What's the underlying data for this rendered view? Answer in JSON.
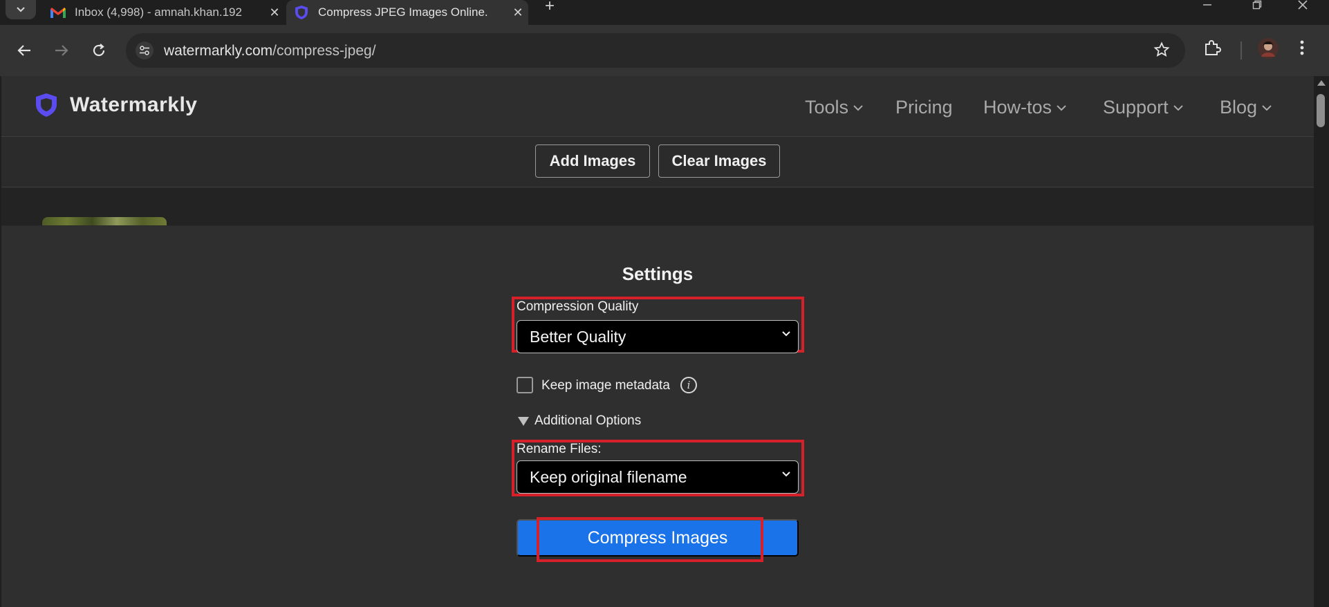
{
  "browser": {
    "tabs": [
      {
        "title": "Inbox (4,998) - amnah.khan.192",
        "favicon": "gmail-icon",
        "active": false
      },
      {
        "title": "Compress JPEG Images Online.",
        "favicon": "watermarkly-shield-icon",
        "active": true
      }
    ],
    "new_tab_label": "+",
    "close_glyph": "✕",
    "url_host": "watermarkly.com",
    "url_path": "/compress-jpeg/"
  },
  "site": {
    "brand": "Watermarkly",
    "brand_color": "#5b4cf0",
    "nav": [
      {
        "label": "Tools",
        "has_menu": true
      },
      {
        "label": "Pricing",
        "has_menu": false
      },
      {
        "label": "How-tos",
        "has_menu": true
      },
      {
        "label": "Support",
        "has_menu": true
      },
      {
        "label": "Blog",
        "has_menu": true
      }
    ]
  },
  "actions": {
    "add_images": "Add Images",
    "clear_images": "Clear Images"
  },
  "settings": {
    "title": "Settings",
    "compression_label": "Compression Quality",
    "compression_value": "Better Quality",
    "metadata_label": "Keep image metadata",
    "metadata_checked": false,
    "additional_options": "Additional Options",
    "rename_label": "Rename Files:",
    "rename_value": "Keep original filename",
    "compress_button": "Compress Images"
  },
  "colors": {
    "highlight": "#d6202a",
    "primary_button": "#1a73e8"
  }
}
